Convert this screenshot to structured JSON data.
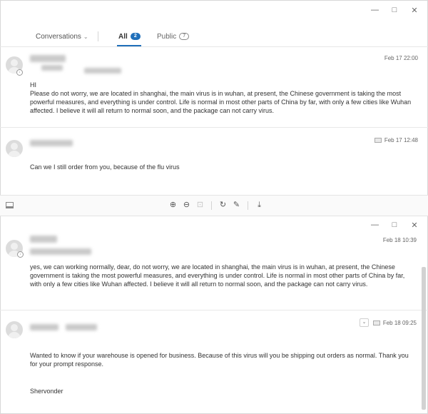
{
  "window": {
    "minimize": "—",
    "maximize": "□",
    "close": "✕"
  },
  "tabs": {
    "conversations_label": "Conversations",
    "conversations_chevron": "⌄",
    "all_label": "All",
    "all_count": "2",
    "public_label": "Public",
    "public_count": "7"
  },
  "messages": [
    {
      "timestamp": "Feb 17 22:00",
      "greeting": "HI",
      "body": "Please do not worry, we are located in shanghai, the main virus is in wuhan, at present, the Chinese government is taking the most powerful measures,  and everything is under control. Life is normal in most other parts of China by far, with only a few cities like Wuhan affected. I believe it will all return to normal soon, and the package can not carry virus."
    },
    {
      "timestamp": "Feb 17 12:48",
      "body": "Can we I still order from you, because of the flu virus"
    },
    {
      "timestamp": "Feb 18 10:39",
      "body": "yes, we can working normally, dear,  do not worry, we are located in shanghai, the main virus is in wuhan, at present, the Chinese government is taking the most powerful measures,  and everything is under control. Life is normal in most other parts of China by far, with only a few cities like Wuhan affected. I believe it will all return to normal soon, and the package can not carry virus."
    },
    {
      "timestamp": "Feb 18 09:25",
      "body": "Wanted to know if your warehouse is opened for business. Because of this virus will you be shipping out orders as normal. Thank you for your prompt response.",
      "signature": "Shervonder"
    }
  ],
  "toolbar": {
    "icons": [
      "panel-icon",
      "zoom-in-icon",
      "zoom-out-icon",
      "fit-icon",
      "rotate-icon",
      "edit-icon",
      "download-icon"
    ],
    "zoom_in": "⊕",
    "zoom_out": "⊖",
    "fit": "⊡",
    "rotate": "↻",
    "edit": "✎",
    "download": "⤓"
  },
  "colors": {
    "accent": "#1f6fba",
    "divider": "#e8e8e8"
  }
}
